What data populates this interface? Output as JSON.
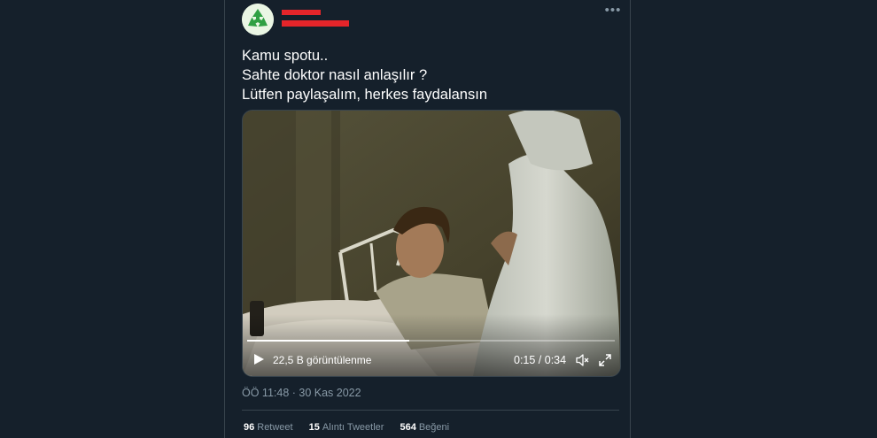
{
  "tweet": {
    "text_lines": [
      "Kamu spotu..",
      "Sahte doktor nasıl anlaşılır ?",
      "Lütfen paylaşalım, herkes faydalansın"
    ],
    "timestamp": "ÖÖ 11:48 · 30 Kas 2022",
    "more_icon": "more-horizontal-icon"
  },
  "video": {
    "views": "22,5 B görüntülenme",
    "time": "0:15 / 0:34",
    "progress_fraction": 0.44
  },
  "stats": {
    "retweets_count": "96",
    "retweets_label": "Retweet",
    "quotes_count": "15",
    "quotes_label": "Alıntı Tweetler",
    "likes_count": "564",
    "likes_label": "Beğeni"
  },
  "colors": {
    "background": "#15202b",
    "border": "#38444d",
    "secondary_text": "#8899a6",
    "redaction": "#e5252a"
  }
}
